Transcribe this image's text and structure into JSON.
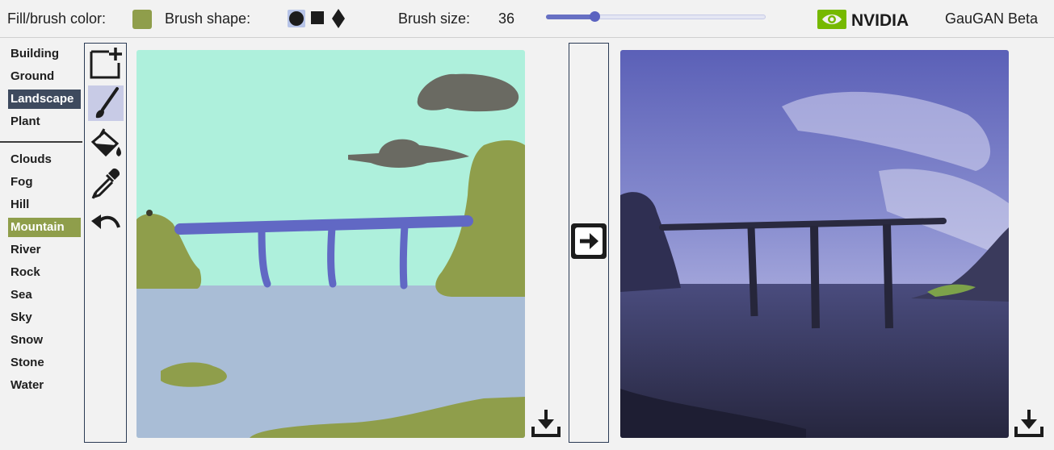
{
  "toolbar_top": {
    "fill_label": "Fill/brush color:",
    "fill_color": "#8f9e4b",
    "brush_shape_label": "Brush shape:",
    "brush_shapes": [
      "circle",
      "square",
      "diamond"
    ],
    "selected_shape": "circle",
    "brush_size_label": "Brush size:",
    "brush_size": "36",
    "brush_size_fraction": 0.22
  },
  "brand": {
    "logo_text": "NVIDIA",
    "app_title": "GauGAN Beta"
  },
  "labels": {
    "group1": [
      "Building",
      "Ground",
      "Landscape",
      "Plant"
    ],
    "group2": [
      "Clouds",
      "Fog",
      "Hill",
      "Mountain",
      "River",
      "Rock",
      "Sea",
      "Sky",
      "Snow",
      "Stone",
      "Water"
    ],
    "selected_group1": "Landscape",
    "selected_group2": "Mountain"
  },
  "tools": [
    "new-canvas-icon",
    "brush-icon",
    "fill-bucket-icon",
    "eyedropper-icon",
    "undo-icon"
  ],
  "active_tool": "brush-icon",
  "colors": {
    "sky": "#aef0dc",
    "sea": "#a9bdd6",
    "mountain": "#8f9e4b",
    "clouds": "#6a6a62",
    "bridge": "#6168c4",
    "accent": "#6770c3",
    "selected_label": "#3e4a5e"
  },
  "icons": {
    "render": "arrow-right-icon",
    "download": "download-icon"
  }
}
